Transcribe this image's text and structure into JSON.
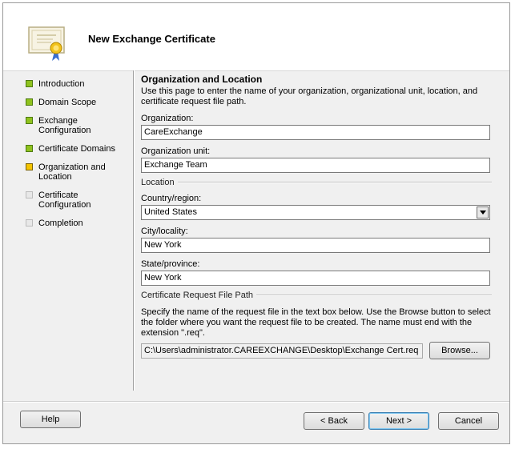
{
  "header": {
    "title": "New Exchange Certificate",
    "icon": "certificate-icon"
  },
  "colors": {
    "done": "#8fc21e",
    "current": "#f4c400",
    "pending": "#e8e8e8"
  },
  "nav": {
    "items": [
      {
        "label": "Introduction",
        "state": "done"
      },
      {
        "label": "Domain Scope",
        "state": "done"
      },
      {
        "label": "Exchange Configuration",
        "state": "done"
      },
      {
        "label": "Certificate Domains",
        "state": "done"
      },
      {
        "label": "Organization and Location",
        "state": "current"
      },
      {
        "label": "Certificate Configuration",
        "state": "pending"
      },
      {
        "label": "Completion",
        "state": "pending"
      }
    ]
  },
  "main": {
    "section_title": "Organization and Location",
    "description": "Use this page to enter the name of your organization, organizational unit, location, and certificate request file path.",
    "organization": {
      "label": "Organization:",
      "value": "CareExchange"
    },
    "org_unit": {
      "label": "Organization unit:",
      "value": "Exchange Team"
    },
    "location_group": "Location",
    "country": {
      "label": "Country/region:",
      "value": "United States"
    },
    "city": {
      "label": "City/locality:",
      "value": "New York"
    },
    "state": {
      "label": "State/province:",
      "value": "New York"
    },
    "request_group": "Certificate Request File Path",
    "request_desc": "Specify the name of the request file in the text box below. Use the Browse button to select the folder where you want the request file to be created. The name must end with the extension \".req\".",
    "request_path": "C:\\Users\\administrator.CAREEXCHANGE\\Desktop\\Exchange Cert.req",
    "browse_label": "Browse..."
  },
  "footer": {
    "help_label": "Help",
    "back_label": "< Back",
    "next_label": "Next >",
    "cancel_label": "Cancel"
  }
}
